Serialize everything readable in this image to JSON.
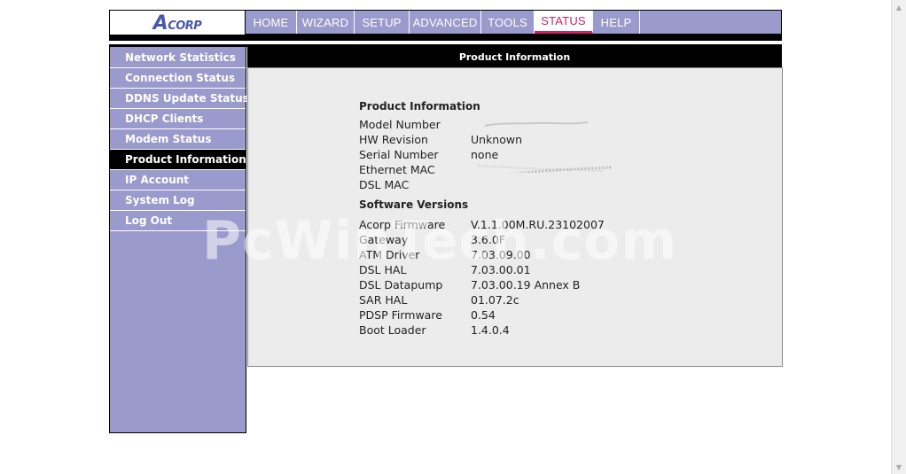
{
  "logo": {
    "text": "CORP",
    "initial": "A"
  },
  "nav": {
    "tabs": [
      {
        "label": "HOME",
        "active": false
      },
      {
        "label": "WIZARD",
        "active": false
      },
      {
        "label": "SETUP",
        "active": false
      },
      {
        "label": "ADVANCED",
        "active": false
      },
      {
        "label": "TOOLS",
        "active": false
      },
      {
        "label": "STATUS",
        "active": true
      },
      {
        "label": "HELP",
        "active": false
      }
    ]
  },
  "sidebar": {
    "items": [
      {
        "label": "Network Statistics"
      },
      {
        "label": "Connection Status"
      },
      {
        "label": "DDNS Update Status"
      },
      {
        "label": "DHCP Clients"
      },
      {
        "label": "Modem Status"
      },
      {
        "label": "Product Information",
        "active": true
      },
      {
        "label": "IP Account"
      },
      {
        "label": "System Log"
      },
      {
        "label": "Log Out"
      }
    ]
  },
  "main": {
    "header": "Product Information",
    "product_title": "Product Information",
    "product_rows": [
      {
        "label": "Model Number",
        "value": ""
      },
      {
        "label": "HW Revision",
        "value": "Unknown"
      },
      {
        "label": "Serial Number",
        "value": "none"
      },
      {
        "label": "Ethernet MAC",
        "value": ""
      },
      {
        "label": "DSL MAC",
        "value": ""
      }
    ],
    "software_title": "Software Versions",
    "software_rows": [
      {
        "label": "Acorp Firmware",
        "value": "V.1.1.00M.RU.23102007"
      },
      {
        "label": "Gateway",
        "value": "3.6.0F"
      },
      {
        "label": "ATM Driver",
        "value": "7.03.09.00"
      },
      {
        "label": "DSL HAL",
        "value": "7.03.00.01"
      },
      {
        "label": "DSL Datapump",
        "value": "7.03.00.19 Annex B"
      },
      {
        "label": "SAR HAL",
        "value": "01.07.2c"
      },
      {
        "label": "PDSP Firmware",
        "value": "0.54"
      },
      {
        "label": "Boot Loader",
        "value": "1.4.0.4"
      }
    ]
  },
  "watermark": "PcWinTech.com",
  "colors": {
    "nav_bg": "#9a9acc",
    "active_tab": "#cc2266",
    "panel_bg": "#ececec"
  }
}
